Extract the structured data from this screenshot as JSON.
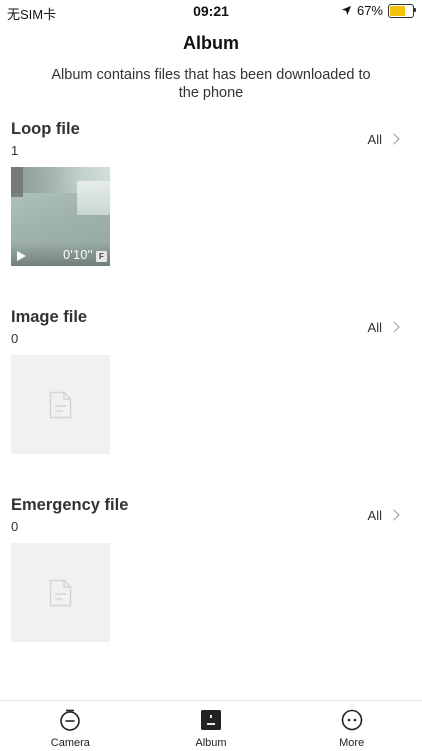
{
  "status_bar": {
    "carrier": "无SIM卡",
    "time": "09:21",
    "battery_percent": "67%",
    "battery_level": 0.67,
    "battery_color": "#f4c20d"
  },
  "header": {
    "title": "Album",
    "subtitle": "Album contains files that has been downloaded to the phone"
  },
  "sections": [
    {
      "title": "Loop file",
      "count": "1",
      "all_label": "All",
      "items": [
        {
          "type": "video",
          "duration": "0'10''",
          "badge": "F"
        }
      ]
    },
    {
      "title": "Image file",
      "count": "0",
      "all_label": "All",
      "items": []
    },
    {
      "title": "Emergency file",
      "count": "0",
      "all_label": "All",
      "items": []
    }
  ],
  "tab_bar": {
    "tabs": [
      {
        "label": "Camera",
        "icon": "camera-icon"
      },
      {
        "label": "Album",
        "icon": "album-icon",
        "active": true
      },
      {
        "label": "More",
        "icon": "more-icon"
      }
    ]
  }
}
